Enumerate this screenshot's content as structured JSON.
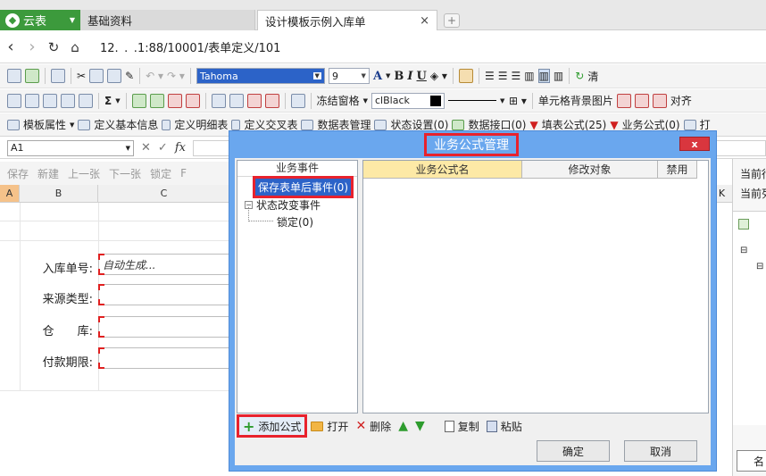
{
  "app": {
    "logo_text": "云表"
  },
  "tabs": [
    {
      "label": "基础资料"
    },
    {
      "label": "设计模板示例入库单",
      "close": "×"
    }
  ],
  "new_tab": "+",
  "address": {
    "url": "12. . .1:88/10001/表单定义/101"
  },
  "toolbar1": {
    "font_name": "Tahoma",
    "font_size": "9",
    "bold": "B",
    "italic": "I",
    "underline": "U",
    "sigma": "Σ",
    "clear_label": "清"
  },
  "toolbar2": {
    "freeze_label": "冻结窗格",
    "color_name": "clBlack",
    "bgimage_label": "单元格背景图片",
    "align_label": "对齐"
  },
  "toolbar3": {
    "items": [
      "模板属性",
      "定义基本信息",
      "定义明细表",
      "定义交叉表",
      "数据表管理",
      "状态设置(0)",
      "数据接口(0)",
      "填表公式(25)",
      "业务公式(0)",
      "打"
    ]
  },
  "formula_bar": {
    "cell_ref": "A1",
    "fx": "fx"
  },
  "actions": [
    "保存",
    "新建",
    "上一张",
    "下一张",
    "锁定",
    "F"
  ],
  "grid": {
    "columns": [
      "A",
      "B",
      "C"
    ],
    "fields": [
      {
        "label": "入库单号:",
        "value": "自动生成..."
      },
      {
        "label": "来源类型:",
        "value": ""
      },
      {
        "label": "仓  库:",
        "value": ""
      },
      {
        "label": "付款期限:",
        "value": ""
      }
    ]
  },
  "right_panel": {
    "col_k": "K",
    "line1": "当前行",
    "line2": "当前列",
    "bottom_label": "名"
  },
  "dialog": {
    "title": "业务公式管理",
    "close": "x",
    "tree_header": "业务事件",
    "tree": {
      "save_event": "保存表单后事件(0)",
      "state_event": "状态改变事件",
      "lock_event": "锁定(0)"
    },
    "table_headers": [
      "业务公式名",
      "修改对象",
      "禁用"
    ],
    "buttons": {
      "add": "添加公式",
      "open": "打开",
      "delete": "删除",
      "copy": "复制",
      "paste": "粘贴"
    },
    "ok": "确定",
    "cancel": "取消"
  },
  "colors": {
    "dialog_blue": "#6aa7ee",
    "highlight_red": "#e8222d",
    "selection_blue": "#2c63c8",
    "brand_green": "#3c9a3c"
  }
}
